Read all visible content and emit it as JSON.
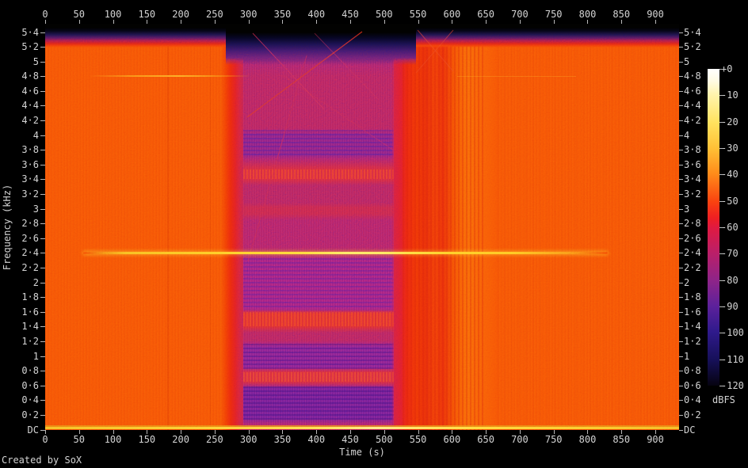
{
  "credit": "Created by SoX",
  "axes": {
    "time": {
      "label": "Time (s)",
      "ticks": [
        "0",
        "50",
        "100",
        "150",
        "200",
        "250",
        "300",
        "350",
        "400",
        "450",
        "500",
        "550",
        "600",
        "650",
        "700",
        "750",
        "800",
        "850",
        "900"
      ]
    },
    "freq": {
      "label": "Frequency (kHz)",
      "ticks": [
        "5·4",
        "5·2",
        "5",
        "4·8",
        "4·6",
        "4·4",
        "4·2",
        "4",
        "3·8",
        "3·6",
        "3·4",
        "3·2",
        "3",
        "2·8",
        "2·6",
        "2·4",
        "2·2",
        "2",
        "1·8",
        "1·6",
        "1·4",
        "1·2",
        "1",
        "0·8",
        "0·6",
        "0·4",
        "0·2",
        "DC"
      ]
    },
    "level": {
      "unit": "dBFS",
      "ticks": [
        "+0",
        "-10",
        "-20",
        "-30",
        "-40",
        "-50",
        "-60",
        "-70",
        "-80",
        "-90",
        "-100",
        "-110",
        "-120"
      ]
    }
  },
  "colors": {
    "background": "#000000",
    "label_text": "#d4d4d4",
    "noise_floor_orange": "#f24b07",
    "quiet_block_purple": "#93217f",
    "tone_line_yellow": "#ffd94e",
    "hf_rolloff_black": "#010101",
    "colorbar_stops": [
      "#ffffff",
      "#fff4ae",
      "#ffe25e",
      "#ffc136",
      "#ff8c1a",
      "#fa4210",
      "#e01a40",
      "#bb1f68",
      "#8d2489",
      "#5c219b",
      "#2f1a8c",
      "#161058",
      "#060310"
    ]
  },
  "chart_data": {
    "type": "heatmap",
    "subtype": "audio-spectrogram",
    "title": "",
    "xlabel": "Time (s)",
    "ylabel": "Frequency (kHz)",
    "colorbar_label": "dBFS",
    "x_range_s": [
      0,
      935
    ],
    "x_ticks_s": [
      0,
      50,
      100,
      150,
      200,
      250,
      300,
      350,
      400,
      450,
      500,
      550,
      600,
      650,
      700,
      750,
      800,
      850,
      900
    ],
    "y_range_khz": [
      0,
      5.51
    ],
    "y_ticks_khz": [
      5.4,
      5.2,
      5.0,
      4.8,
      4.6,
      4.4,
      4.2,
      4.0,
      3.8,
      3.6,
      3.4,
      3.2,
      3.0,
      2.8,
      2.6,
      2.4,
      2.2,
      2.0,
      1.8,
      1.6,
      1.4,
      1.2,
      1.0,
      0.8,
      0.6,
      0.4,
      0.2,
      0.0
    ],
    "z_range_dbfs": [
      -120,
      0
    ],
    "z_ticks_dbfs": [
      0,
      -10,
      -20,
      -30,
      -40,
      -50,
      -60,
      -70,
      -80,
      -90,
      -100,
      -110,
      -120
    ],
    "grid": false,
    "legend_position": "right-colorbar",
    "features": [
      {
        "name": "broadband-noise-floor",
        "time_s": [
          0,
          935
        ],
        "freq_khz": [
          0,
          5.2
        ],
        "level_dbfs": -45,
        "color": "orange"
      },
      {
        "name": "quiet-segment-block",
        "time_s": [
          292,
          525
        ],
        "freq_khz": [
          0,
          5.5
        ],
        "level_dbfs": -80,
        "color": "purple",
        "detail": "banded horizontal structure with faint diagonal sweeps"
      },
      {
        "name": "post-segment-striped-zone",
        "time_s": [
          525,
          640
        ],
        "freq_khz": [
          0,
          5.2
        ],
        "level_dbfs": -48,
        "color": "red with vertical striping"
      },
      {
        "name": "tone-2.4kHz",
        "freq_khz": 2.4,
        "time_s": [
          58,
          822
        ],
        "level_dbfs": -18,
        "color": "yellow"
      },
      {
        "name": "tone-4.8kHz",
        "freq_khz": 4.8,
        "time_s": [
          74,
          296
        ],
        "level_dbfs": -35,
        "color": "faint orange-yellow"
      },
      {
        "name": "dc-low-frequency-line",
        "freq_khz": 0.02,
        "time_s": [
          0,
          935
        ],
        "level_dbfs": -20,
        "color": "yellow"
      },
      {
        "name": "hf-rolloff-above-5.2kHz",
        "freq_khz": [
          5.25,
          5.51
        ],
        "time_s": [
          0,
          935
        ],
        "level_dbfs": -110,
        "color": "black-to-blue gradient"
      }
    ]
  }
}
